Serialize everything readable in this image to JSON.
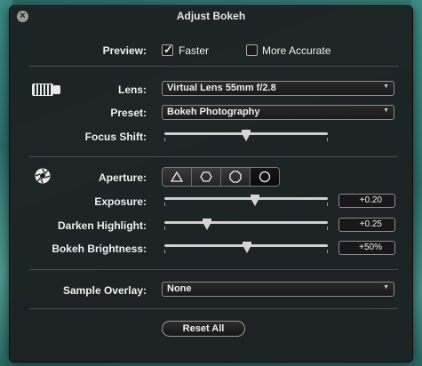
{
  "window": {
    "title": "Adjust Bokeh"
  },
  "preview": {
    "label": "Preview:",
    "faster": {
      "label": "Faster",
      "checked": true
    },
    "more_accurate": {
      "label": "More Accurate",
      "checked": false
    }
  },
  "lens": {
    "label": "Lens:",
    "value": "Virtual Lens 55mm f/2.8",
    "icon": "lens-icon"
  },
  "preset": {
    "label": "Preset:",
    "value": "Bokeh Photography"
  },
  "focus_shift": {
    "label": "Focus Shift:",
    "level": 0.5
  },
  "aperture": {
    "label": "Aperture:",
    "icon": "aperture-icon",
    "shapes": [
      "triangle",
      "hexagon",
      "octagon",
      "circle"
    ],
    "selected": "circle"
  },
  "exposure": {
    "label": "Exposure:",
    "value": "+0.20",
    "level": 0.55
  },
  "darken_highlight": {
    "label": "Darken Highlight:",
    "value": "+0.25",
    "level": 0.25
  },
  "bokeh_brightness": {
    "label": "Bokeh Brightness:",
    "value": "+50%",
    "level": 0.5
  },
  "sample_overlay": {
    "label": "Sample Overlay:",
    "value": "None"
  },
  "reset_button": {
    "label": "Reset All"
  },
  "colors": {
    "panel": "#1c1e1f",
    "text": "#f0f0f0",
    "divider": "#4a4d4f"
  }
}
